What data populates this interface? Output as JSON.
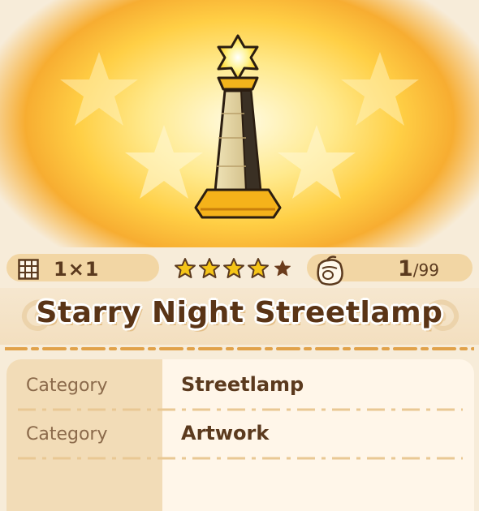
{
  "item": {
    "name": "Starry Night Streetlamp",
    "size": "1×1",
    "rarity_stars_filled": 4,
    "rarity_stars_total": 5,
    "count_current": "1",
    "count_max": "/99"
  },
  "details": [
    {
      "label": "Category",
      "value": "Streetlamp"
    },
    {
      "label": "Category",
      "value": "Artwork"
    }
  ],
  "icons": {
    "size": "grid-icon",
    "rarity": "star-icon",
    "storage": "bag-icon"
  },
  "colors": {
    "accent_gold": "#f7ad31",
    "text_brown": "#5b3a1e",
    "label_brown": "#8b6a4b",
    "star_filled": "#f5c518",
    "star_empty": "#6b3c1c"
  }
}
